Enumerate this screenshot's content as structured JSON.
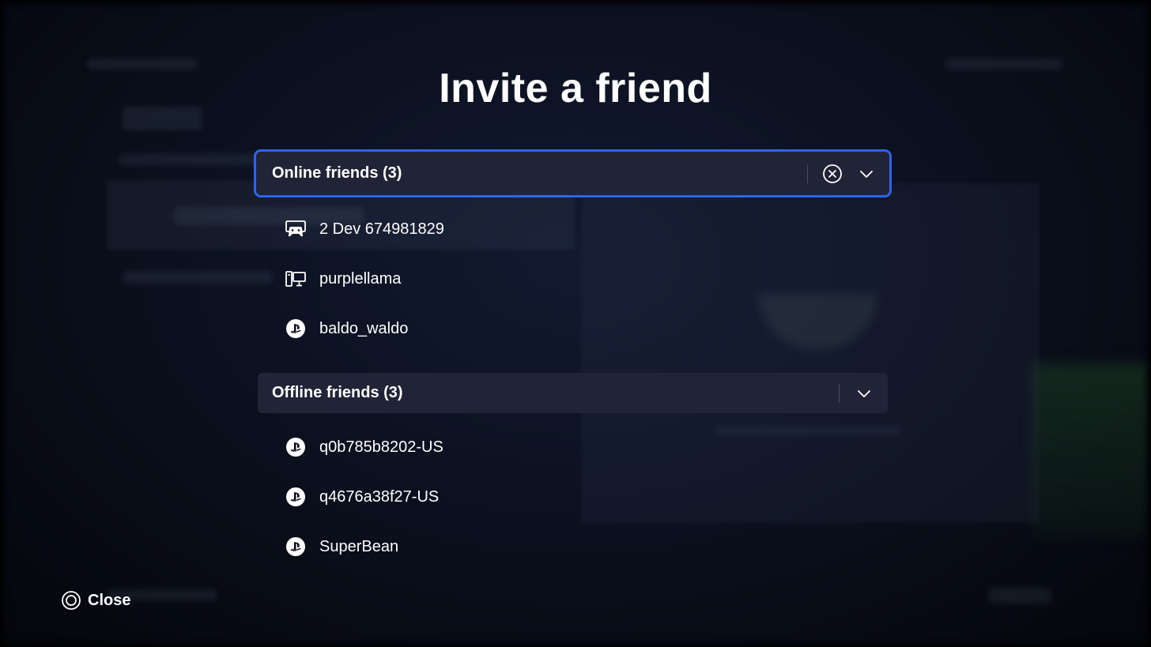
{
  "dialog": {
    "title": "Invite a friend"
  },
  "online_section": {
    "label": "Online friends (3)",
    "clear_icon": "circle-x-icon",
    "expand_icon": "chevron-down-icon",
    "friends": [
      {
        "name": "2 Dev 674981829",
        "platform_icon": "console-icon"
      },
      {
        "name": "purplellama",
        "platform_icon": "pc-icon"
      },
      {
        "name": "baldo_waldo",
        "platform_icon": "playstation-icon"
      }
    ]
  },
  "offline_section": {
    "label": "Offline friends (3)",
    "expand_icon": "chevron-down-icon",
    "friends": [
      {
        "name": "q0b785b8202-US",
        "platform_icon": "playstation-icon"
      },
      {
        "name": "q4676a38f27-US",
        "platform_icon": "playstation-icon"
      },
      {
        "name": "SuperBean",
        "platform_icon": "playstation-icon"
      }
    ]
  },
  "footer": {
    "close_label": "Close",
    "close_icon": "circle-button-icon"
  },
  "colors": {
    "focus_border": "#2d64ec",
    "header_bg": "#212436",
    "background": "#0a0f1c"
  }
}
